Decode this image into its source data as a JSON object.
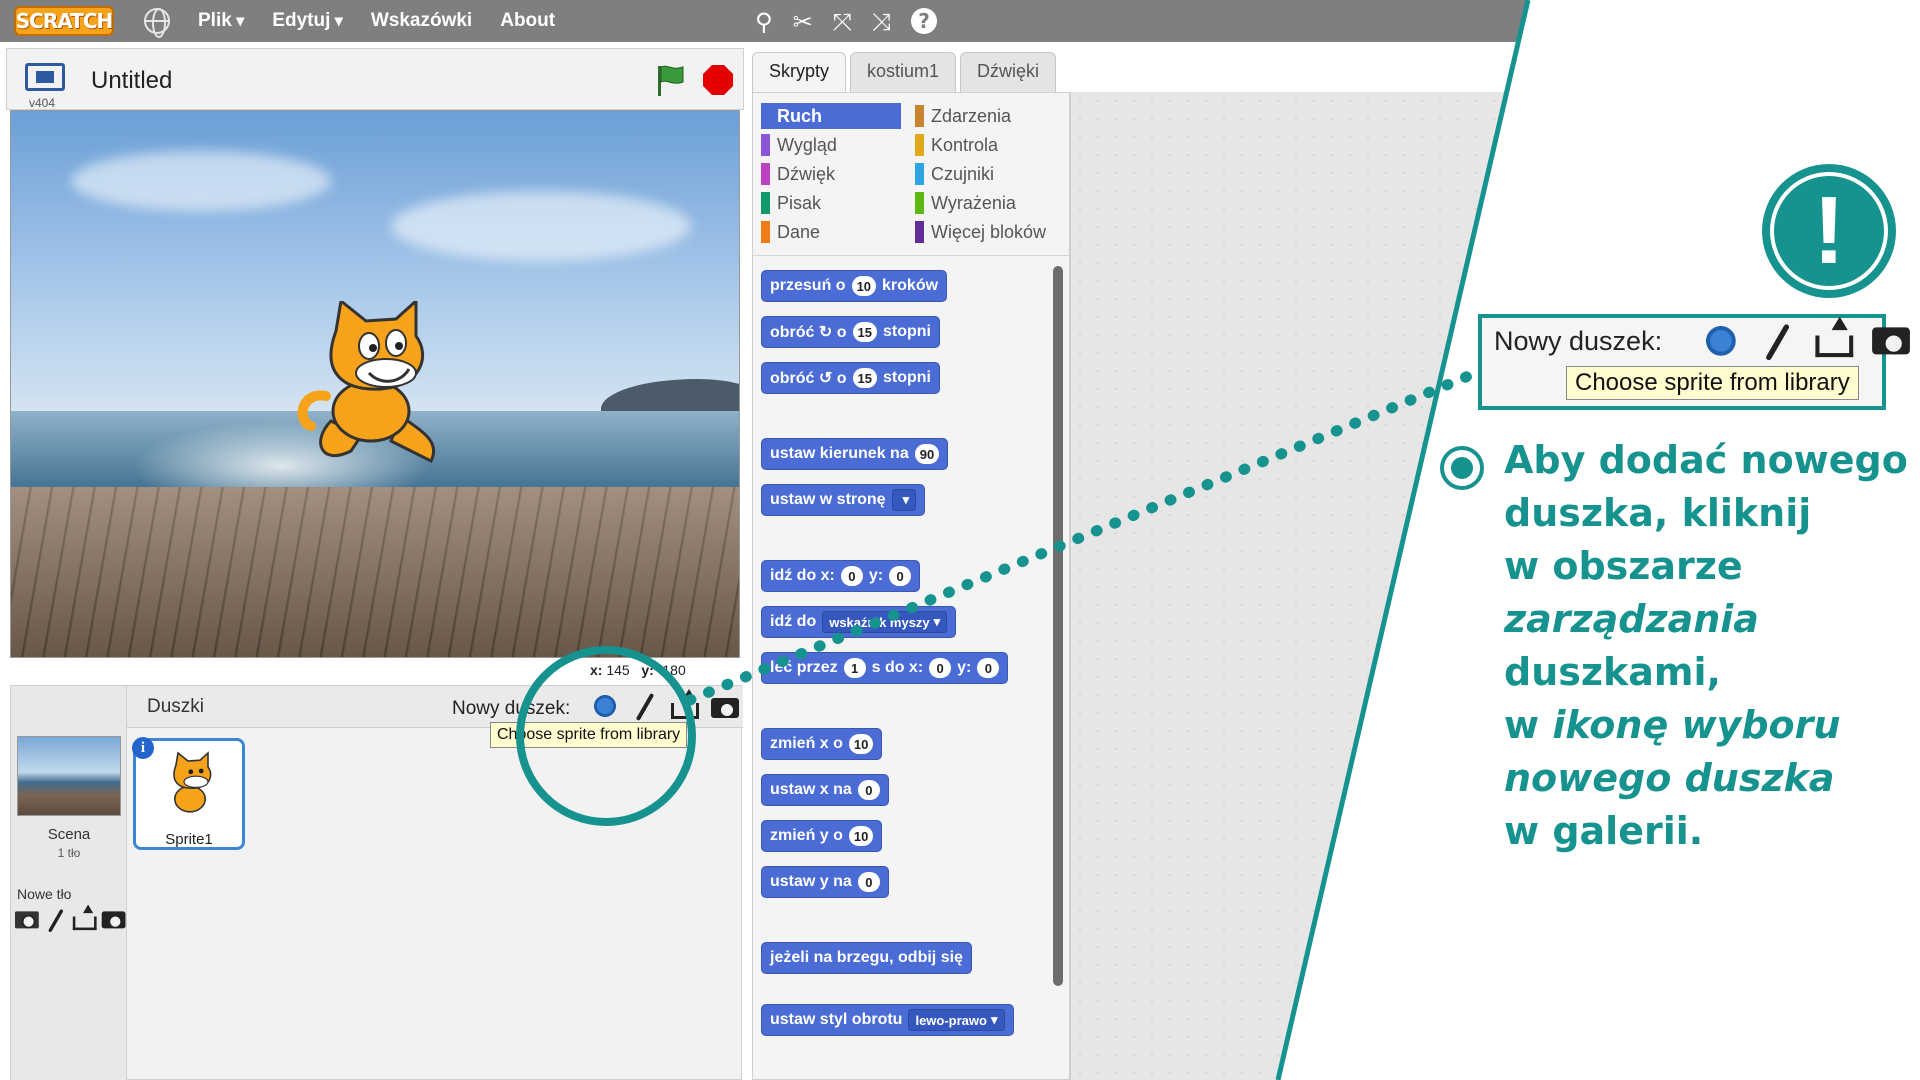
{
  "menubar": {
    "logo": "SCRATCH",
    "items": [
      "Plik",
      "Edytuj",
      "Wskazówki",
      "About"
    ],
    "help": "?"
  },
  "stage": {
    "title": "Untitled",
    "version": "v404",
    "coords_x_label": "x:",
    "coords_x": "145",
    "coords_y_label": "y:",
    "coords_y": "-180"
  },
  "sprites_panel": {
    "title": "Duszki",
    "new_sprite_label": "Nowy duszek:",
    "tooltip": "Choose sprite from library",
    "scene_label": "Scena",
    "scene_count": "1 tło",
    "new_backdrop_label": "Nowe tło",
    "sprite_name": "Sprite1",
    "info": "i"
  },
  "tabs": [
    "Skrypty",
    "kostium1",
    "Dźwięki"
  ],
  "categories": {
    "left": [
      {
        "label": "Ruch",
        "color": "#4a6cd4"
      },
      {
        "label": "Wygląd",
        "color": "#8a55d7"
      },
      {
        "label": "Dźwięk",
        "color": "#bb42c3"
      },
      {
        "label": "Pisak",
        "color": "#0e9a6c"
      },
      {
        "label": "Dane",
        "color": "#ee7d16"
      }
    ],
    "right": [
      {
        "label": "Zdarzenia",
        "color": "#c88330"
      },
      {
        "label": "Kontrola",
        "color": "#e1a91a"
      },
      {
        "label": "Czujniki",
        "color": "#2ca5e2"
      },
      {
        "label": "Wyrażenia",
        "color": "#5cb712"
      },
      {
        "label": "Więcej bloków",
        "color": "#632d99"
      }
    ]
  },
  "blocks": {
    "b1_a": "przesuń o",
    "b1_n": "10",
    "b1_b": "kroków",
    "b2_a": "obróć ↻ o",
    "b2_n": "15",
    "b2_b": "stopni",
    "b3_a": "obróć ↺ o",
    "b3_n": "15",
    "b3_b": "stopni",
    "b4_a": "ustaw kierunek na",
    "b4_n": "90",
    "b5_a": "ustaw w stronę",
    "b6_a": "idź do x:",
    "b6_n1": "0",
    "b6_b": "y:",
    "b6_n2": "0",
    "b7_a": "idź do",
    "b7_d": "wskaźnik myszy",
    "b8_a": "leć przez",
    "b8_n1": "1",
    "b8_b": "s do x:",
    "b8_n2": "0",
    "b8_c": "y:",
    "b8_n3": "0",
    "b9_a": "zmień x o",
    "b9_n": "10",
    "b10_a": "ustaw x na",
    "b10_n": "0",
    "b11_a": "zmień y o",
    "b11_n": "10",
    "b12_a": "ustaw y na",
    "b12_n": "0",
    "b13_a": "jeżeli na brzegu, odbij się",
    "b14_a": "ustaw styl obrotu",
    "b14_d": "lewo-prawo"
  },
  "callout": {
    "label": "Nowy duszek:",
    "tooltip": "Choose sprite from library",
    "exclamation": "!",
    "line1": "Aby dodać nowego",
    "line2": "duszka, kliknij",
    "line3": "w obszarze",
    "line4_i": "zarządzania",
    "line4_b": " duszkami,",
    "line5_a": "w ",
    "line5_i": "ikonę  wyboru",
    "line6_i": "nowego duszka",
    "line7": "w galerii.",
    "accent": "#16938f"
  }
}
